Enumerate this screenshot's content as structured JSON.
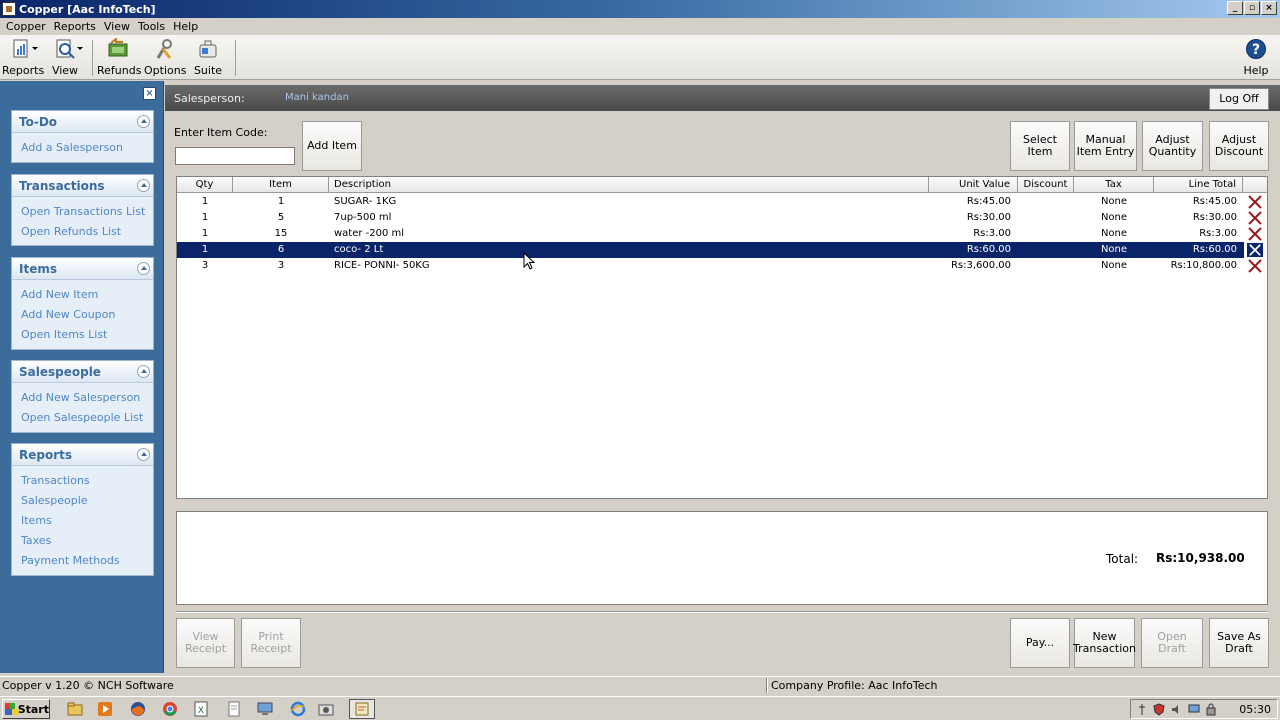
{
  "window": {
    "title": "Copper [Aac InfoTech]"
  },
  "menu": [
    "Copper",
    "Reports",
    "View",
    "Tools",
    "Help"
  ],
  "toolbar": {
    "reports": "Reports",
    "view": "View",
    "refunds": "Refunds",
    "options": "Options",
    "suite": "Suite",
    "help": "Help"
  },
  "sidebar": {
    "todo": {
      "title": "To-Do",
      "links": [
        "Add a Salesperson"
      ]
    },
    "transactions": {
      "title": "Transactions",
      "links": [
        "Open Transactions List",
        "Open Refunds List"
      ]
    },
    "items": {
      "title": "Items",
      "links": [
        "Add New Item",
        "Add New Coupon",
        "Open Items List"
      ]
    },
    "salespeople": {
      "title": "Salespeople",
      "links": [
        "Add New Salesperson",
        "Open Salespeople List"
      ]
    },
    "reports": {
      "title": "Reports",
      "links": [
        "Transactions",
        "Salespeople",
        "Items",
        "Taxes",
        "Payment Methods"
      ]
    }
  },
  "salesbar": {
    "label": "Salesperson:",
    "value": "Mani kandan",
    "logoff": "Log Off"
  },
  "entry": {
    "label": "Enter Item Code:",
    "value": "",
    "add_item": "Add Item",
    "select_item": "Select Item",
    "manual_entry_1": "Manual",
    "manual_entry_2": "Item Entry",
    "adjust_qty_1": "Adjust",
    "adjust_qty_2": "Quantity",
    "adjust_disc_1": "Adjust",
    "adjust_disc_2": "Discount"
  },
  "table": {
    "headers": [
      "Qty",
      "Item",
      "Description",
      "Unit Value",
      "Discount",
      "Tax",
      "Line Total"
    ],
    "rows": [
      {
        "qty": "1",
        "item": "1",
        "desc": "SUGAR- 1KG",
        "unit": "Rs:45.00",
        "disc": "",
        "tax": "None",
        "total": "Rs:45.00"
      },
      {
        "qty": "1",
        "item": "5",
        "desc": "7up-500 ml",
        "unit": "Rs:30.00",
        "disc": "",
        "tax": "None",
        "total": "Rs:30.00"
      },
      {
        "qty": "1",
        "item": "15",
        "desc": "water -200 ml",
        "unit": "Rs:3.00",
        "disc": "",
        "tax": "None",
        "total": "Rs:3.00"
      },
      {
        "qty": "1",
        "item": "6",
        "desc": "coco- 2 Lt",
        "unit": "Rs:60.00",
        "disc": "",
        "tax": "None",
        "total": "Rs:60.00"
      },
      {
        "qty": "3",
        "item": "3",
        "desc": "RICE- PONNI- 50KG",
        "unit": "Rs:3,600.00",
        "disc": "",
        "tax": "None",
        "total": "Rs:10,800.00"
      }
    ],
    "selected_row": 3
  },
  "totals": {
    "label": "Total:",
    "value": "Rs:10,938.00"
  },
  "actions": {
    "view_receipt_1": "View",
    "view_receipt_2": "Receipt",
    "print_receipt_1": "Print",
    "print_receipt_2": "Receipt",
    "pay": "Pay...",
    "new_tx_1": "New",
    "new_tx_2": "Transaction",
    "open_draft": "Open Draft",
    "save_draft_1": "Save As",
    "save_draft_2": "Draft"
  },
  "status": {
    "left": "Copper v 1.20 © NCH Software",
    "right": "Company Profile: Aac InfoTech"
  },
  "taskbar": {
    "start": "Start",
    "clock": "05:30"
  },
  "colors": {
    "sidebar": "#3c6c9c",
    "link": "#4f87c4",
    "selection": "#0a246a",
    "delete": "#9e1b1b"
  }
}
